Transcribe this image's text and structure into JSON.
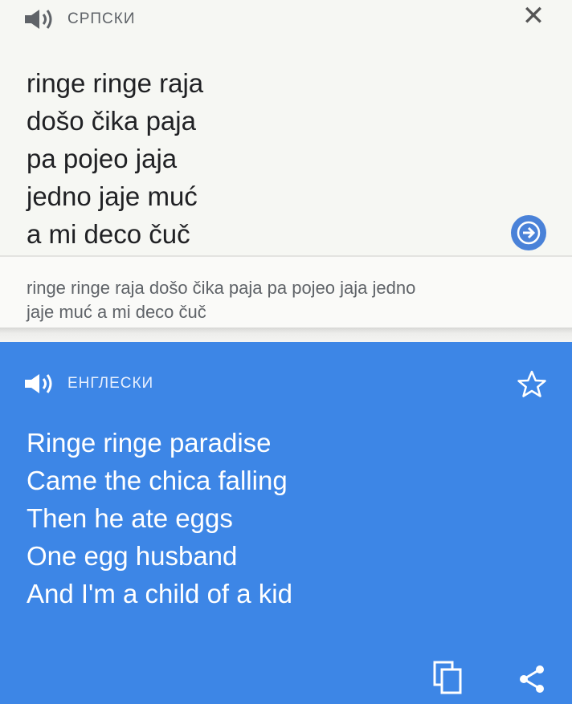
{
  "source": {
    "language": "СРПСКИ",
    "lines": [
      "ringe ringe raja",
      "došo čika paja",
      "pa pojeo jaja",
      "jedno jaje muć",
      "a mi deco čuč"
    ],
    "transliteration_lines": [
      "ringe ringe raja došo čika paja pa pojeo jaja jedno",
      "jaje muć a mi deco čuč"
    ],
    "icons": {
      "speaker": "speaker-icon",
      "close": "close-icon",
      "submit": "arrow-right-icon"
    }
  },
  "target": {
    "language": "ЕНГЛЕСКИ",
    "lines": [
      "Ringe ringe paradise",
      "Came the chica falling",
      "Then he ate eggs",
      "One egg husband",
      "And I'm a child of a kid"
    ],
    "icons": {
      "speaker": "speaker-icon",
      "favorite": "star-icon",
      "copy": "copy-icon",
      "share": "share-icon"
    }
  },
  "colors": {
    "translation_panel": "#3d86e6",
    "go_button": "#4a82d8"
  },
  "close_glyph": "✕"
}
